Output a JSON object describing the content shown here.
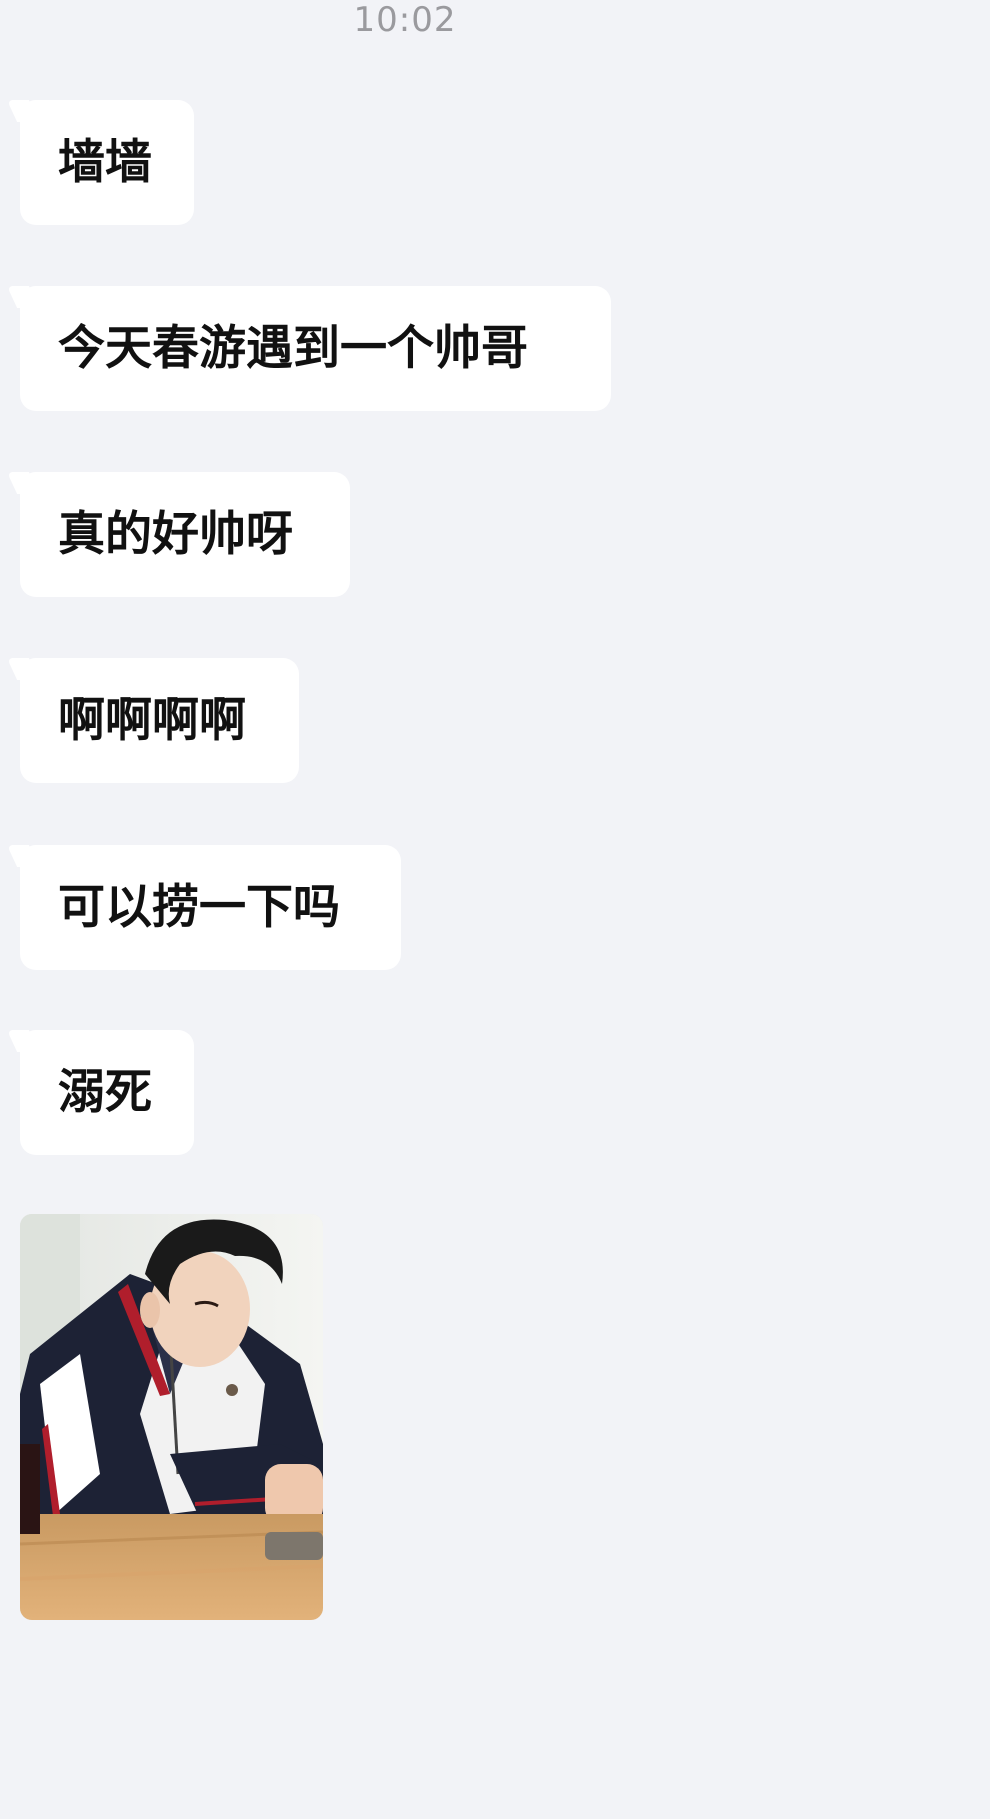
{
  "status": {
    "time": "10:02"
  },
  "messages": [
    {
      "text": "墙墙"
    },
    {
      "text": "今天春游遇到一个帅哥"
    },
    {
      "text": "真的好帅呀"
    },
    {
      "text": "啊啊啊啊"
    },
    {
      "text": "可以捞一下吗"
    },
    {
      "text": "溺死"
    }
  ],
  "photo": {
    "subject": "boy in school tracksuit at wooden table"
  },
  "colors": {
    "background": "#f2f3f7",
    "bubble": "#ffffff",
    "text": "#111111",
    "timestamp": "#9a9a9e"
  }
}
